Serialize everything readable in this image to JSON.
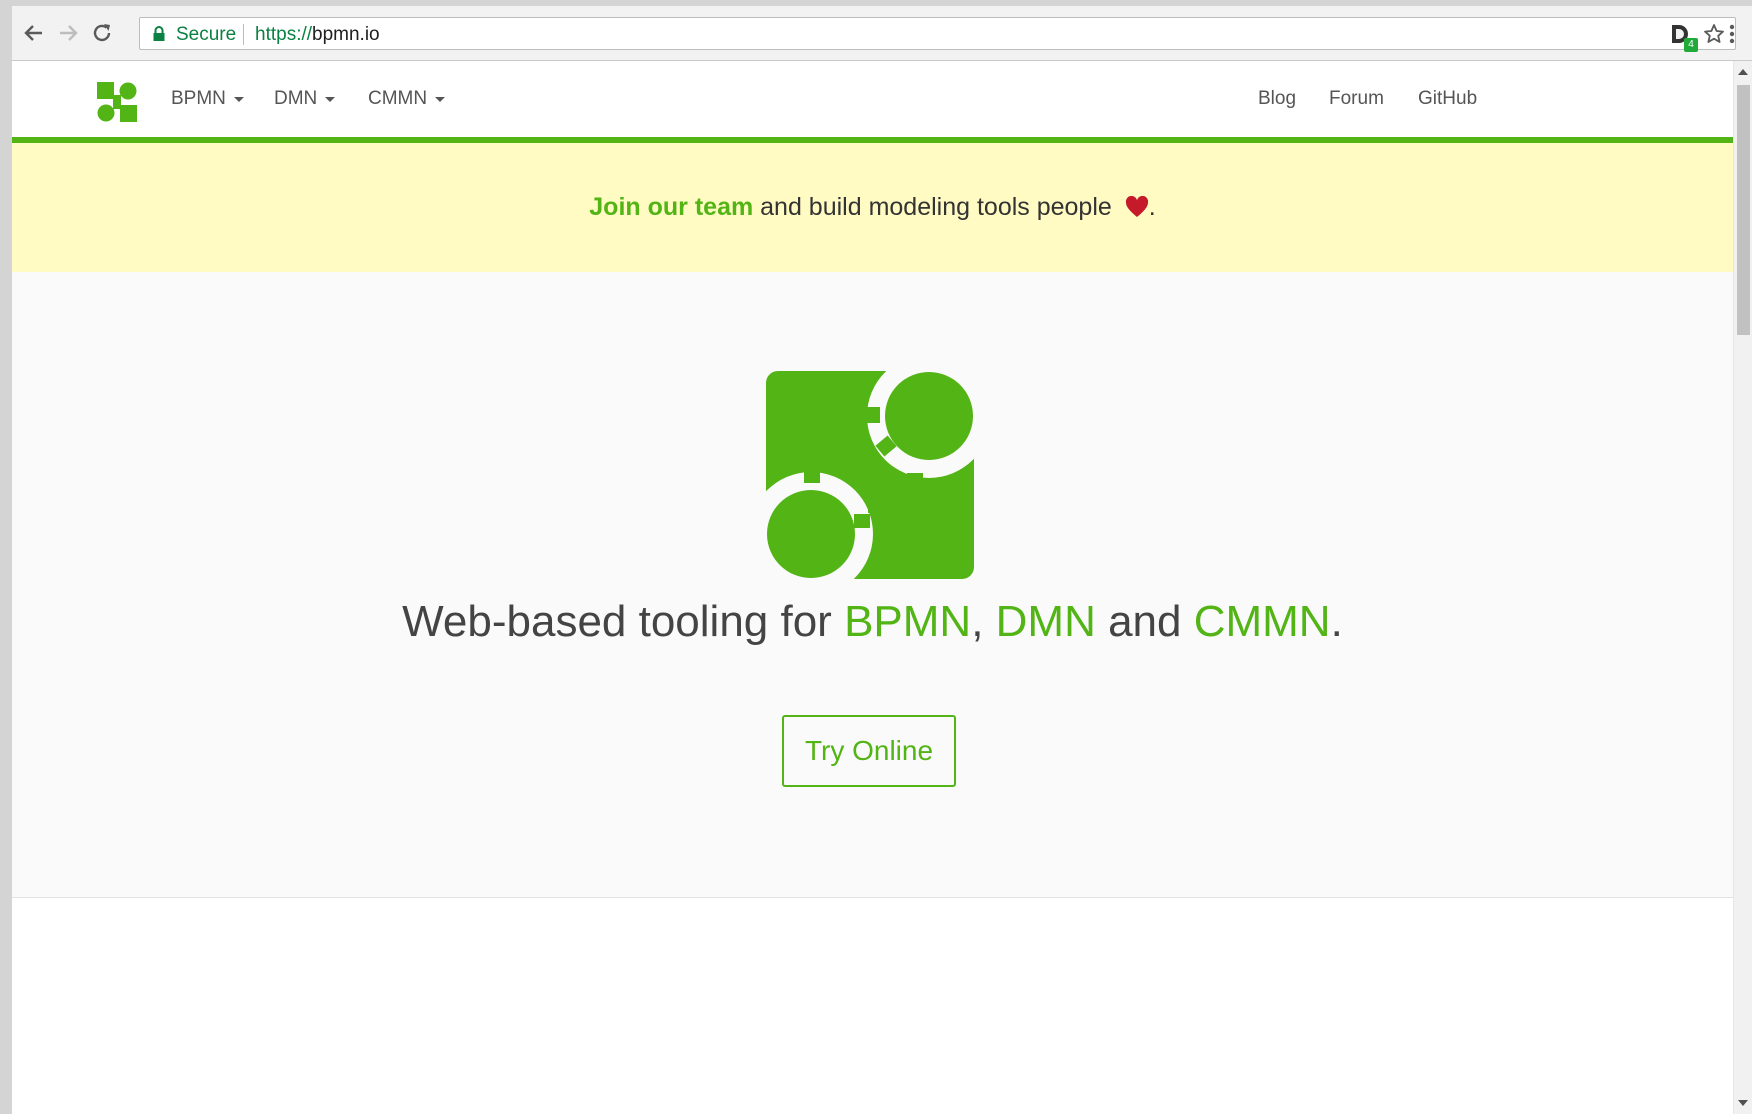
{
  "browser": {
    "secure_label": "Secure",
    "url_scheme": "https://",
    "url_host": "bpmn.io",
    "extension_badge": "4"
  },
  "navbar": {
    "left_items": [
      {
        "label": "BPMN"
      },
      {
        "label": "DMN"
      },
      {
        "label": "CMMN"
      }
    ],
    "right_items": [
      {
        "label": "Blog"
      },
      {
        "label": "Forum"
      },
      {
        "label": "GitHub"
      }
    ]
  },
  "banner": {
    "link_text": "Join our team",
    "text": " and build modeling tools people ",
    "suffix": "."
  },
  "hero": {
    "headline_prefix": "Web-based tooling for ",
    "hl1": "BPMN",
    "sep1": ", ",
    "hl2": "DMN",
    "sep2": " and ",
    "hl3": "CMMN",
    "suffix": ".",
    "cta_label": "Try Online"
  },
  "colors": {
    "brand_green": "#52b415",
    "banner_bg": "#fffbc2",
    "heart": "#c41a2a"
  }
}
